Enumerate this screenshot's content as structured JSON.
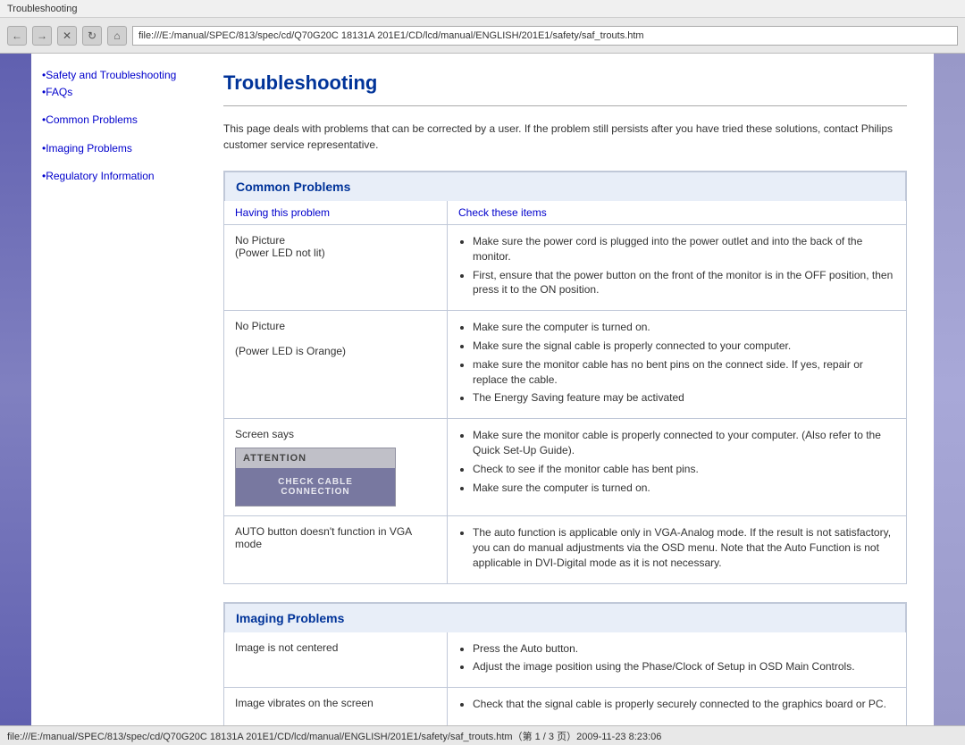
{
  "titleBar": {
    "text": "Troubleshooting"
  },
  "addressBar": {
    "value": "file:///E:/manual/SPEC/813/spec/cd/Q70G20C 18131A 201E1/CD/lcd/manual/ENGLISH/201E1/safety/saf_trouts.htm"
  },
  "statusBar": {
    "text": "file:///E:/manual/SPEC/813/spec/cd/Q70G20C 18131A 201E1/CD/lcd/manual/ENGLISH/201E1/safety/saf_trouts.htm（第 1 / 3 页）2009-11-23 8:23:06"
  },
  "sidebar": {
    "group1": {
      "link1": "•Safety and Troubleshooting",
      "link2": "•FAQs"
    },
    "group2": {
      "link1": "•Common Problems"
    },
    "group3": {
      "link1": "•Imaging Problems"
    },
    "group4": {
      "link1": "•Regulatory Information"
    }
  },
  "page": {
    "title": "Troubleshooting",
    "intro": "This page deals with problems that can be corrected by a user. If the problem still persists after you have tried these solutions, contact Philips customer service representative."
  },
  "commonProblems": {
    "sectionTitle": "Common Problems",
    "columnLeft": "Having this problem",
    "columnRight": "Check these items",
    "rows": [
      {
        "problem": "No Picture\n(Power LED not lit)",
        "solutions": [
          "Make sure the power cord is plugged into the power outlet and into the back of the monitor.",
          "First, ensure that the power button on the front of the monitor is in the OFF position, then press it to the ON position."
        ]
      },
      {
        "problem": "No Picture\n\n(Power LED is Orange)",
        "solutions": [
          "Make sure the computer is turned on.",
          "Make sure the signal cable is properly connected to your computer.",
          "make sure the monitor cable has no bent pins on the connect side. If yes, repair or replace the cable.",
          "The Energy Saving feature may be activated"
        ]
      },
      {
        "problem": "Screen says",
        "attentionHeader": "ATTENTION",
        "attentionBody": "CHECK CABLE CONNECTION",
        "solutions": [
          "Make sure the monitor cable is properly connected to your computer. (Also refer to the Quick Set-Up Guide).",
          "Check to see if the monitor cable has bent pins.",
          "Make sure the computer is turned on."
        ]
      },
      {
        "problem": "AUTO button doesn't function in VGA mode",
        "solutions": [
          "The auto function is applicable only in VGA-Analog mode.  If the result is not satisfactory, you can do manual adjustments via the OSD menu.  Note that the Auto Function is not applicable in DVI-Digital mode as it is not necessary."
        ]
      }
    ]
  },
  "imagingProblems": {
    "sectionTitle": "Imaging Problems",
    "rows": [
      {
        "problem": "Image is not centered",
        "solutions": [
          "Press the Auto button.",
          "Adjust the image position using the Phase/Clock of Setup in OSD Main Controls."
        ]
      },
      {
        "problem": "Image vibrates on the screen",
        "solutions": [
          "Check that the signal cable is properly securely connected to the graphics board or PC."
        ]
      }
    ]
  }
}
